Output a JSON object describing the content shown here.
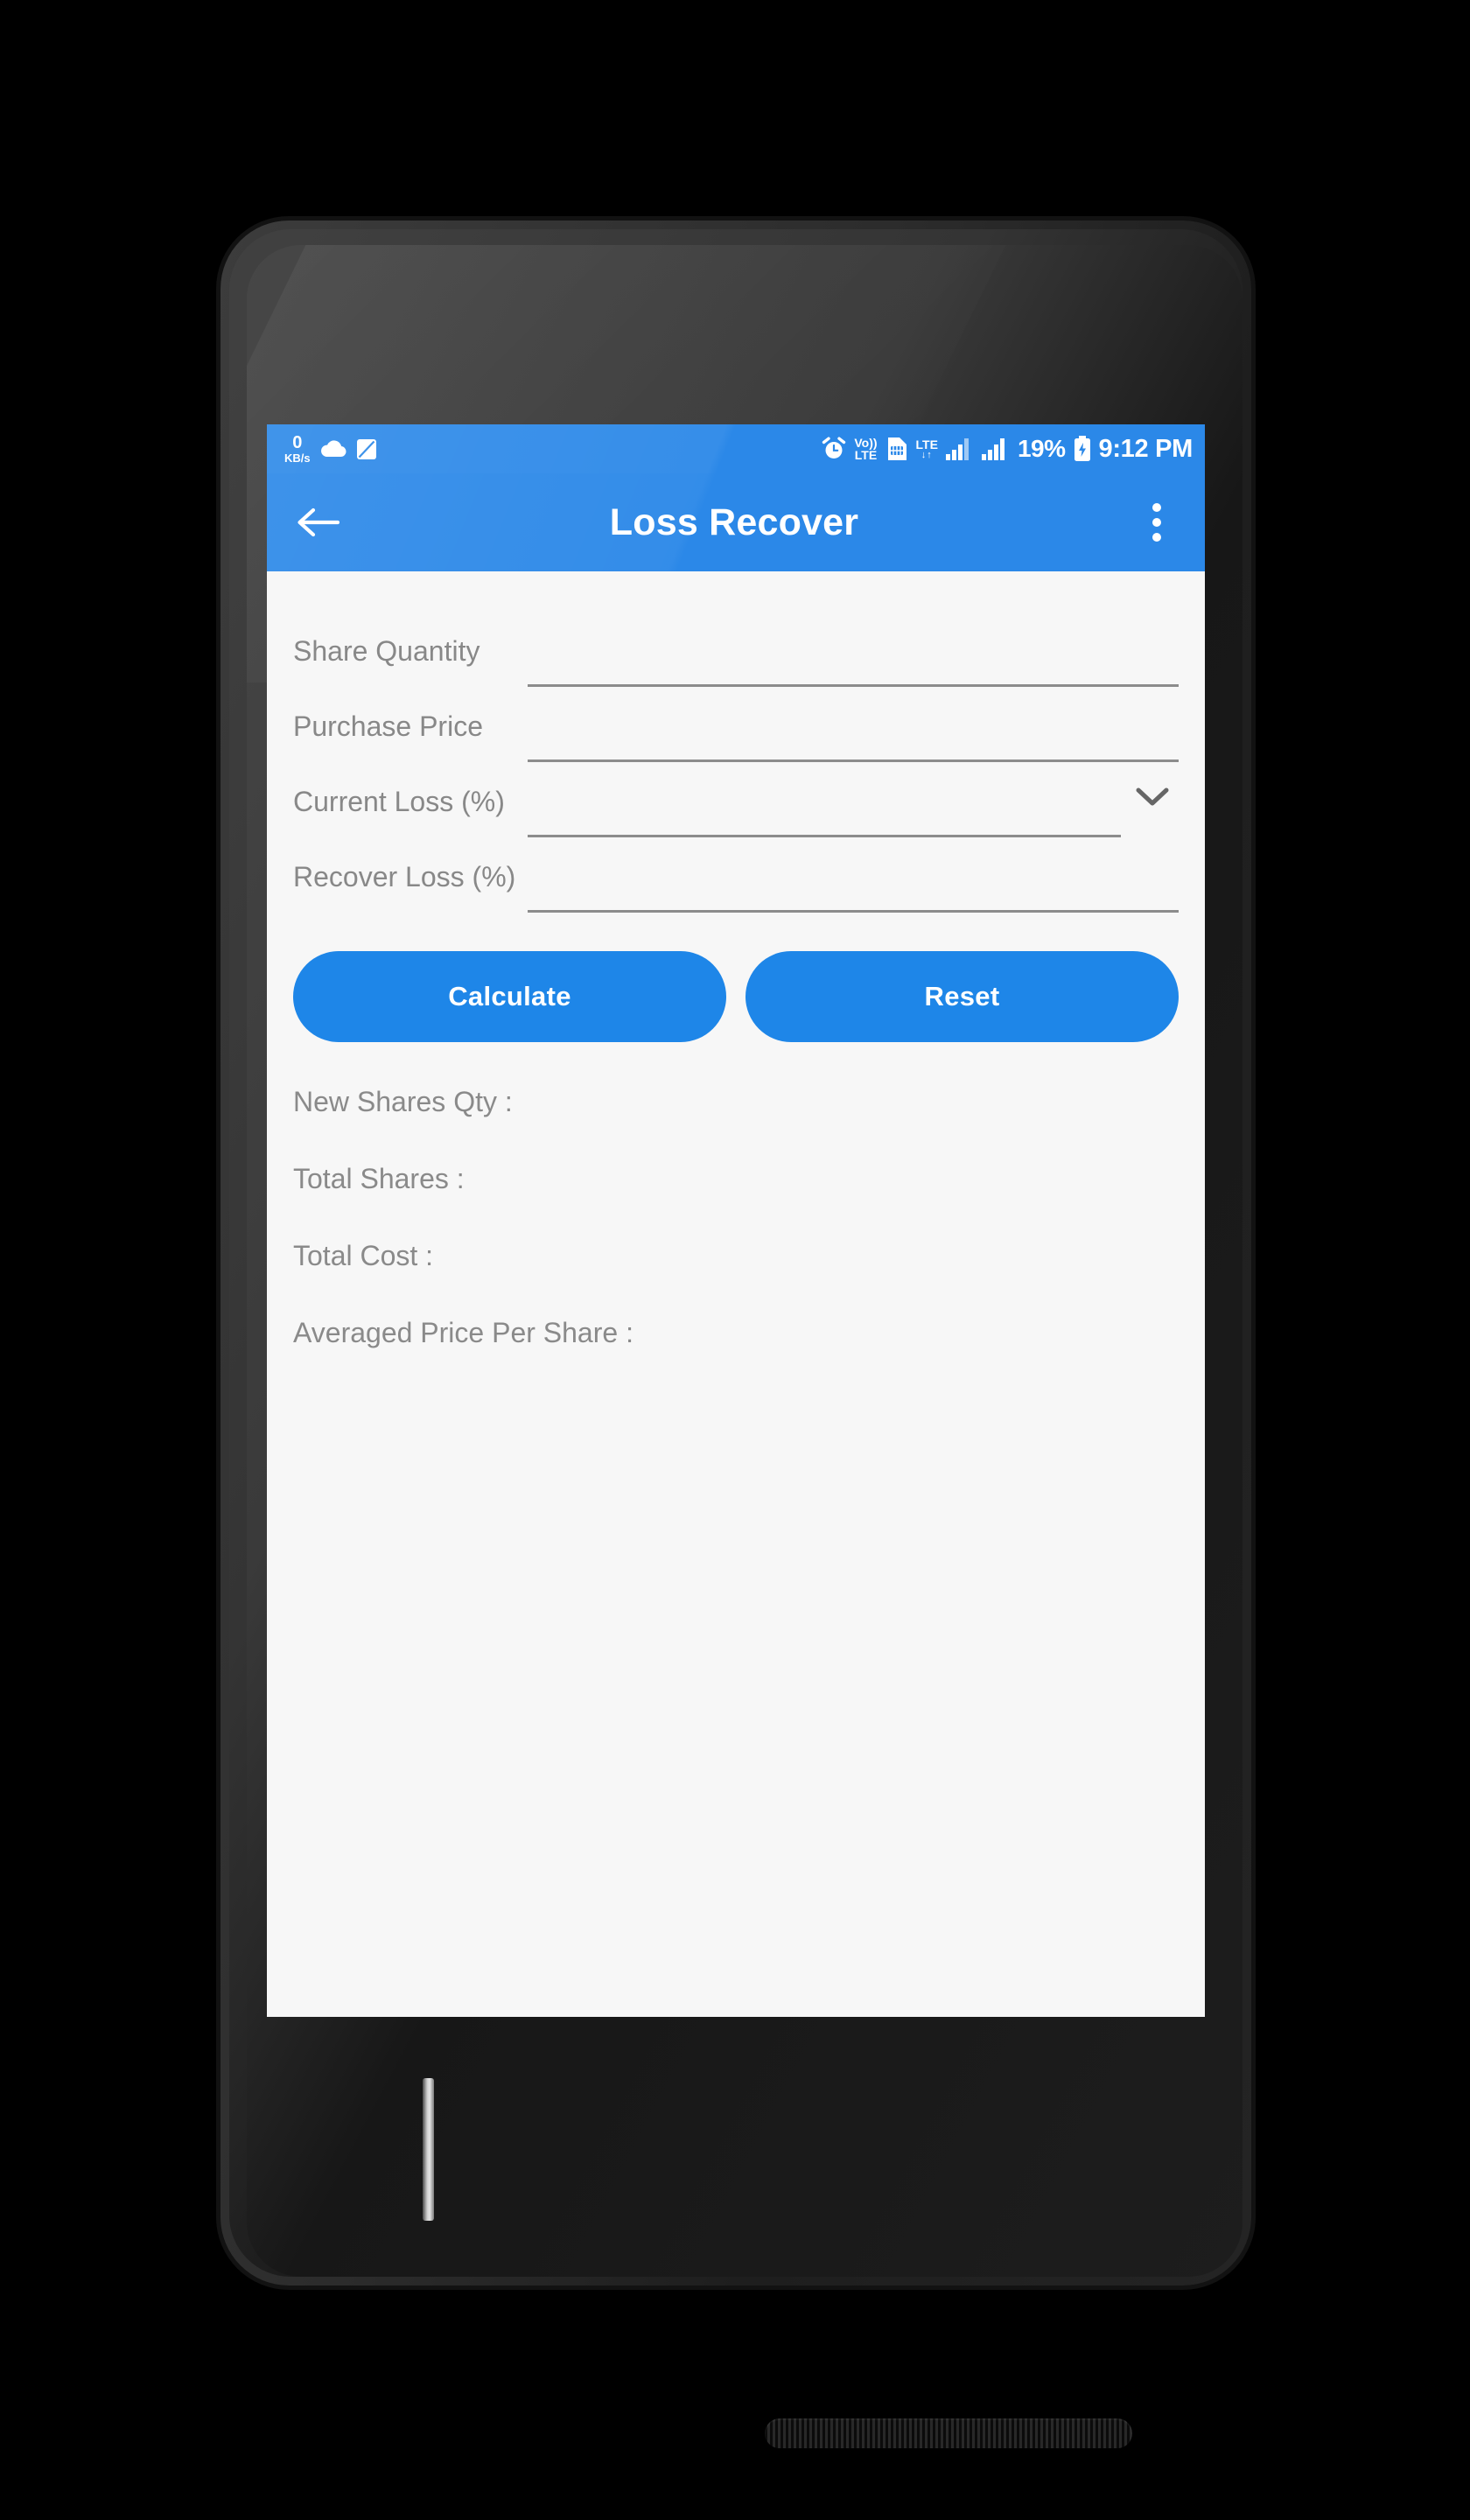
{
  "status_bar": {
    "data_rate_value": "0",
    "data_rate_unit": "KB/s",
    "icons": [
      "cloud-icon",
      "note-icon",
      "alarm-icon",
      "volte-icon",
      "sim-card-icon",
      "lte-data-icon",
      "signal-bars-icon",
      "signal-bars-icon"
    ],
    "volte_top": "Vo))",
    "volte_bottom": "LTE",
    "lte_label": "LTE",
    "lte_arrows": "↓↑",
    "battery_percent": "19%",
    "clock": "9:12 PM"
  },
  "app_bar": {
    "back_icon": "arrow-left-icon",
    "title": "Loss Recover",
    "overflow_icon": "more-vertical-icon"
  },
  "form": {
    "fields": [
      {
        "label": "Share Quantity",
        "value": "",
        "placeholder": "",
        "type": "text",
        "name": "share-quantity"
      },
      {
        "label": "Purchase Price",
        "value": "",
        "placeholder": "",
        "type": "text",
        "name": "purchase-price"
      },
      {
        "label": "Current Loss (%)",
        "value": "",
        "placeholder": "",
        "type": "dropdown",
        "name": "current-loss",
        "chevron_icon": "chevron-down-icon"
      },
      {
        "label": "Recover Loss (%)",
        "value": "",
        "placeholder": "",
        "type": "text",
        "name": "recover-loss"
      }
    ]
  },
  "buttons": {
    "calculate_label": "Calculate",
    "reset_label": "Reset"
  },
  "results": [
    {
      "label": "New Shares Qty :",
      "name": "new-shares-qty"
    },
    {
      "label": "Total Shares :",
      "name": "total-shares"
    },
    {
      "label": "Total Cost :",
      "name": "total-cost"
    },
    {
      "label": "Averaged Price Per Share :",
      "name": "averaged-price-per-share"
    }
  ],
  "colors": {
    "accent": "#2b88e8",
    "button": "#1e86e8",
    "screen_bg": "#f7f7f7",
    "label_text": "#888888",
    "underline": "#8c8c8c"
  }
}
